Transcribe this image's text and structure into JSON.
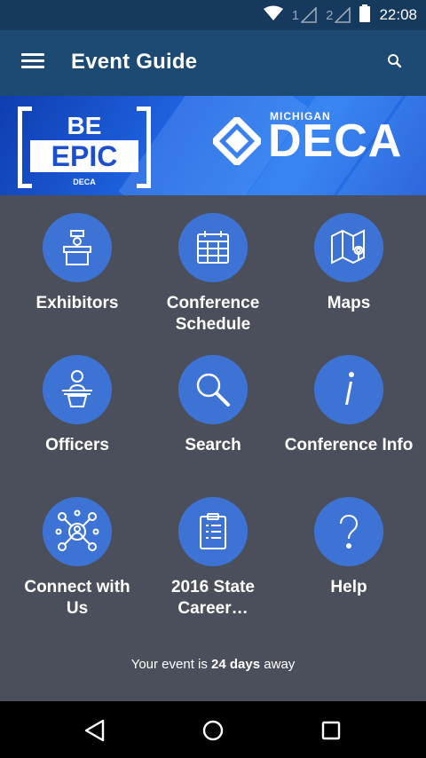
{
  "status_bar": {
    "time": "22:08",
    "sim1": "1",
    "sim2": "2",
    "icons": [
      "wifi-icon",
      "signal-icon",
      "signal-icon",
      "battery-icon"
    ]
  },
  "app_bar": {
    "title": "Event Guide",
    "menu_icon": "hamburger-menu-icon",
    "search_icon": "search-icon"
  },
  "banner": {
    "left_top": "BE",
    "left_main": "EPIC",
    "left_small": "DECA",
    "right_small": "MICHIGAN",
    "right_main": "DECA"
  },
  "tiles": [
    {
      "label": "Exhibitors",
      "icon": "exhibitor-booth-icon"
    },
    {
      "label": "Conference Schedule",
      "icon": "calendar-icon"
    },
    {
      "label": "Maps",
      "icon": "map-pin-icon"
    },
    {
      "label": "Officers",
      "icon": "podium-person-icon"
    },
    {
      "label": "Search",
      "icon": "magnifier-icon"
    },
    {
      "label": "Conference Info",
      "icon": "info-icon"
    },
    {
      "label": "Connect with Us",
      "icon": "network-icon"
    },
    {
      "label": "2016 State Career…",
      "icon": "clipboard-icon"
    },
    {
      "label": "Help",
      "icon": "question-icon"
    }
  ],
  "countdown": {
    "prefix": "Your event is",
    "days": "24 days",
    "suffix": "away"
  },
  "colors": {
    "status_bar": "#163a5e",
    "app_bar": "#1c4a73",
    "background": "#4b4f5c",
    "tile_circle": "#3e73d6"
  },
  "nav_bar": {
    "icons": [
      "back-triangle-icon",
      "home-circle-icon",
      "recents-square-icon"
    ]
  }
}
